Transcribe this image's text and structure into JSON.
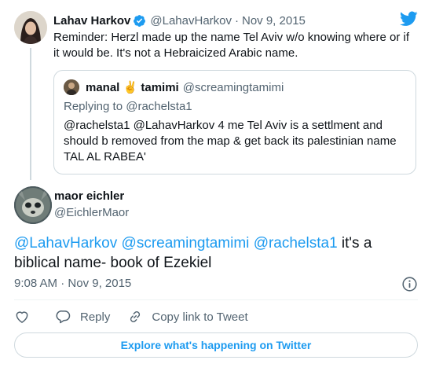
{
  "parent_tweet": {
    "author_name": "Lahav Harkov",
    "handle": "@LahavHarkov",
    "separator": "·",
    "date": "Nov 9, 2015",
    "text": "Reminder: Herzl made up the name Tel Aviv w/o knowing where or if it would be. It's not a Hebraicized Arabic name.",
    "quoted": {
      "author_name": "manal ✌️ tamimi",
      "handle": "@screamingtamimi",
      "replying_prefix": "Replying to",
      "replying_handle": "@rachelsta1",
      "text": "@rachelsta1 @LahavHarkov 4 me Tel Aviv is a settlment and should b removed from the map & get back its palestinian name TAL AL RABEA'"
    }
  },
  "main_tweet": {
    "author_name": "maor eichler",
    "handle": "@EichlerMaor",
    "mentions": [
      "@LahavHarkov",
      "@screamingtamimi",
      "@rachelsta1"
    ],
    "text_rest": " it's a biblical name- book of Ezekiel",
    "time": "9:08 AM",
    "separator": "·",
    "date": "Nov 9, 2015"
  },
  "actions": {
    "reply_label": "Reply",
    "copy_label": "Copy link to Tweet"
  },
  "explore_label": "Explore what's happening on Twitter",
  "icons": {
    "verified": "verified-badge-icon",
    "brand": "twitter-bird-icon",
    "info": "info-icon",
    "like": "heart-icon",
    "reply": "speech-bubble-icon",
    "copy": "link-icon"
  },
  "colors": {
    "accent": "#1d9bf0",
    "text_primary": "#0f1419",
    "text_secondary": "#536471",
    "border": "#cfd9de"
  }
}
